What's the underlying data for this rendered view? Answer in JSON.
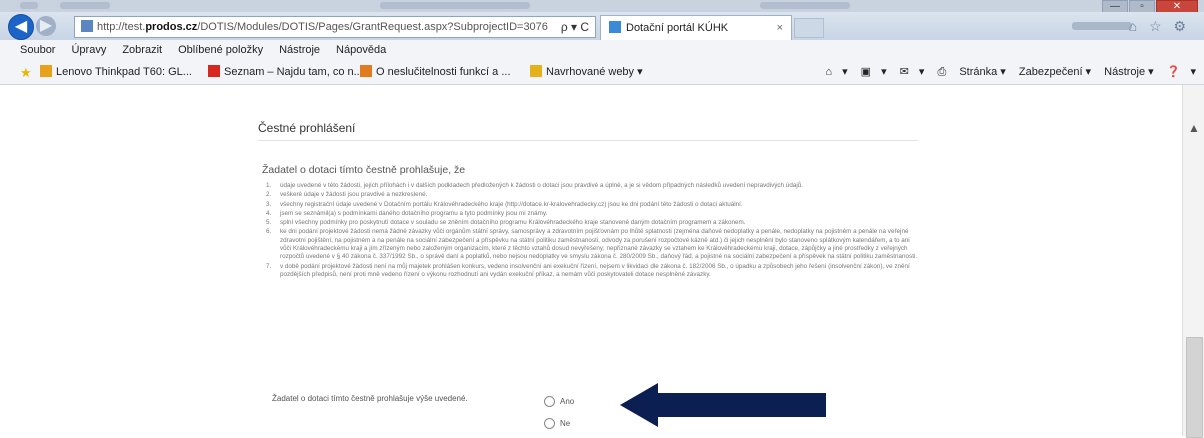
{
  "window": {
    "min": "—",
    "max": "▫",
    "close": "✕"
  },
  "nav": {
    "address_prefix": "http://test.",
    "address_domain": "prodos.cz",
    "address_rest": "/DOTIS/Modules/DOTIS/Pages/GrantRequest.aspx?SubprojectID=3076",
    "address_tools": "ρ ▾ C",
    "tab_title": "Dotační portál KÚHK",
    "tab_close": "×",
    "right_icons": "⌂ ☆ ⚙"
  },
  "menu": [
    "Soubor",
    "Úpravy",
    "Zobrazit",
    "Oblíbené položky",
    "Nástroje",
    "Nápověda"
  ],
  "favorites": [
    {
      "label": "Lenovo Thinkpad T60: GL...",
      "color": "#e8a11c"
    },
    {
      "label": "Seznam – Najdu tam, co n...",
      "color": "#d8271e"
    },
    {
      "label": "O neslučitelnosti funkcí a ...",
      "color": "#e07b1e"
    },
    {
      "label": "Navrhované weby ▾",
      "color": "#e3b21a"
    }
  ],
  "commands": [
    "▾",
    "▾",
    "▾",
    "Stránka ▾",
    "Zabezpečení ▾",
    "Nástroje ▾",
    "▾"
  ],
  "form": {
    "section_title": "Čestné prohlášení",
    "intro": "Žadatel o dotaci tímto čestně prohlašuje, že",
    "items": [
      {
        "num": "1.",
        "text": "údaje uvedené v této žádosti, jejích přílohách i v dalších podkladech předložených k žádosti o dotaci jsou pravdivé a úplné, a je si vědom případných následků uvedení nepravdivých údajů."
      },
      {
        "num": "2.",
        "text": "veškeré údaje v žádosti jsou pravdivé a nezkreslené."
      },
      {
        "num": "3.",
        "text": "všechny registrační údaje uvedené v Dotačním portálu Královéhradeckého kraje (http://dotace.kr-kralovehradecky.cz) jsou ke dni podání této žádosti o dotaci aktuální."
      },
      {
        "num": "4.",
        "text": "jsem se seznámil(a) s podmínkami daného dotačního programu a tyto podmínky jsou mi známy."
      },
      {
        "num": "5.",
        "text": "splní všechny podmínky pro poskytnutí dotace v souladu se zněním dotačního programu Královéhradeckého kraje stanovené daným dotačním programem a zákonem."
      },
      {
        "num": "6.",
        "text": "ke dni podání projektové žádosti nemá žádné závazky vůči orgánům státní správy, samosprávy a zdravotním pojišťovnám po lhůtě splatnosti (zejména daňové nedoplatky a penále, nedoplatky na pojistném a penále na veřejné zdravotní pojištění, na pojistném a na penále na sociální zabezpečení a příspěvku na státní politiku zaměstnanosti, odvody za porušení rozpočtové kázně atd.) či jejich nesplnění bylo stanoveno splátkovým kalendářem, a to ani vůči Královéhradeckému kraji a jím zřízeným nebo založeným organizacím, které z těchto vztahů dosud nevyřešeny; nepřiznané závazky se vztahem ke Královéhradeckému kraji, dotace, zápůjčky a jiné prostředky z veřejných rozpočtů uvedené v § 40 zákona č. 337/1992 Sb., o správě daní a poplatků, nebo nejsou nedoplatky ve smyslu zákona č. 280/2009 Sb., daňový řád, a pojistné na sociální zabezpečení a příspěvek na státní politiku zaměstnanosti."
      },
      {
        "num": "7.",
        "text": "v době podání projektové žádosti není na můj majetek prohlášen konkurs, vedeno insolvenční ani exekuční řízení, nejsem v likvidaci dle zákona č. 182/2006 Sb., o úpadku a způsobech jeho řešení (insolvenční zákon), ve znění pozdějších předpisů, není proti mně vedeno řízení o výkonu rozhodnutí ani vydán exekuční příkaz, a nemám vůči poskytovateli dotace nesplněné závazky."
      }
    ],
    "question": "Žadatel o dotaci tímto čestně prohlašuje výše uvedené.",
    "options": [
      "Ano",
      "Ne"
    ]
  },
  "colors": {
    "arrow": "#0c1f52",
    "accent": "#1d64c9"
  }
}
